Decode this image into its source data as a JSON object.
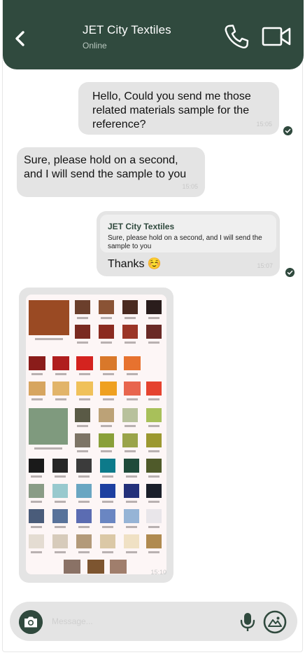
{
  "header": {
    "title": "JET City Textiles",
    "status": "Online",
    "bg_color": "#304a3e"
  },
  "messages": [
    {
      "direction": "outgoing",
      "text": "Hello, Could you send me those related materials sample for the reference?",
      "time": "15:05",
      "status_icon": "check-circle-icon"
    },
    {
      "direction": "incoming",
      "text": "Sure, please hold on a second, and I will send the sample to you",
      "time": "15:05"
    },
    {
      "direction": "outgoing",
      "reply_to": {
        "sender": "JET City Textiles",
        "text": "Sure, please hold on a second, and I will send the sample to you"
      },
      "text": "Thanks ☺️",
      "time": "15:07",
      "status_icon": "check-circle-icon"
    },
    {
      "direction": "incoming",
      "type": "image",
      "image_icon": "fabric-swatch-card-image",
      "time": "15:10"
    }
  ],
  "composer": {
    "placeholder": "Message...",
    "camera_icon": "camera-icon",
    "mic_icon": "microphone-icon",
    "gallery_icon": "gallery-icon"
  }
}
